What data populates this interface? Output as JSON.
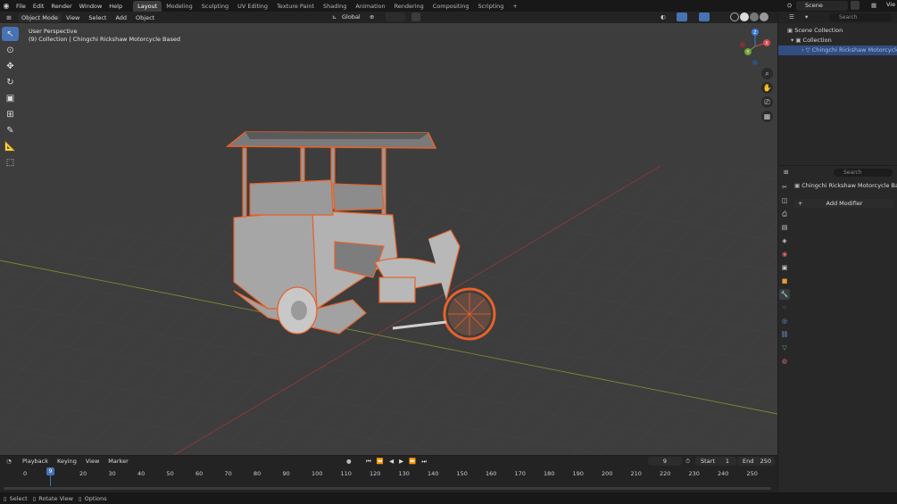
{
  "menu": [
    "File",
    "Edit",
    "Render",
    "Window",
    "Help"
  ],
  "workspaces": [
    "Layout",
    "Modeling",
    "Sculpting",
    "UV Editing",
    "Texture Paint",
    "Shading",
    "Animation",
    "Rendering",
    "Compositing",
    "Scripting"
  ],
  "active_workspace": "Layout",
  "scene_name": "Scene",
  "view_layer": "Vie",
  "header": {
    "mode": "Object Mode",
    "menus": [
      "View",
      "Select",
      "Add",
      "Object"
    ],
    "orientation": "Global"
  },
  "viewport_info": {
    "line1": "User Perspective",
    "line2": "(9) Collection | Chingchi Rickshaw Motorcycle Based"
  },
  "gizmo_axes": [
    "Z",
    "Y",
    "X"
  ],
  "timeline": {
    "menus": [
      "Playback",
      "Keying",
      "View",
      "Marker"
    ],
    "current_frame": "9",
    "start_label": "Start",
    "start": "1",
    "end_label": "End",
    "end": "250",
    "ticks": [
      "0",
      "20",
      "30",
      "40",
      "50",
      "60",
      "70",
      "80",
      "90",
      "100",
      "110",
      "120",
      "130",
      "140",
      "150",
      "160",
      "170",
      "180",
      "190",
      "200",
      "210",
      "220",
      "230",
      "240",
      "250"
    ],
    "playhead": "9"
  },
  "status": [
    "Select",
    "Rotate View",
    "Options"
  ],
  "outliner": {
    "search_placeholder": "Search",
    "scene_collection": "Scene Collection",
    "collection": "Collection",
    "object": "Chingchi Rickshaw Motorcycle B"
  },
  "properties": {
    "search_placeholder": "Search",
    "object_name": "Chingchi Rickshaw Motorcycle Based",
    "add_modifier": "Add Modifier"
  },
  "colors": {
    "accent": "#4772b3",
    "selection_outline": "#e8622a",
    "viewport_bg": "#3d3d3d"
  }
}
